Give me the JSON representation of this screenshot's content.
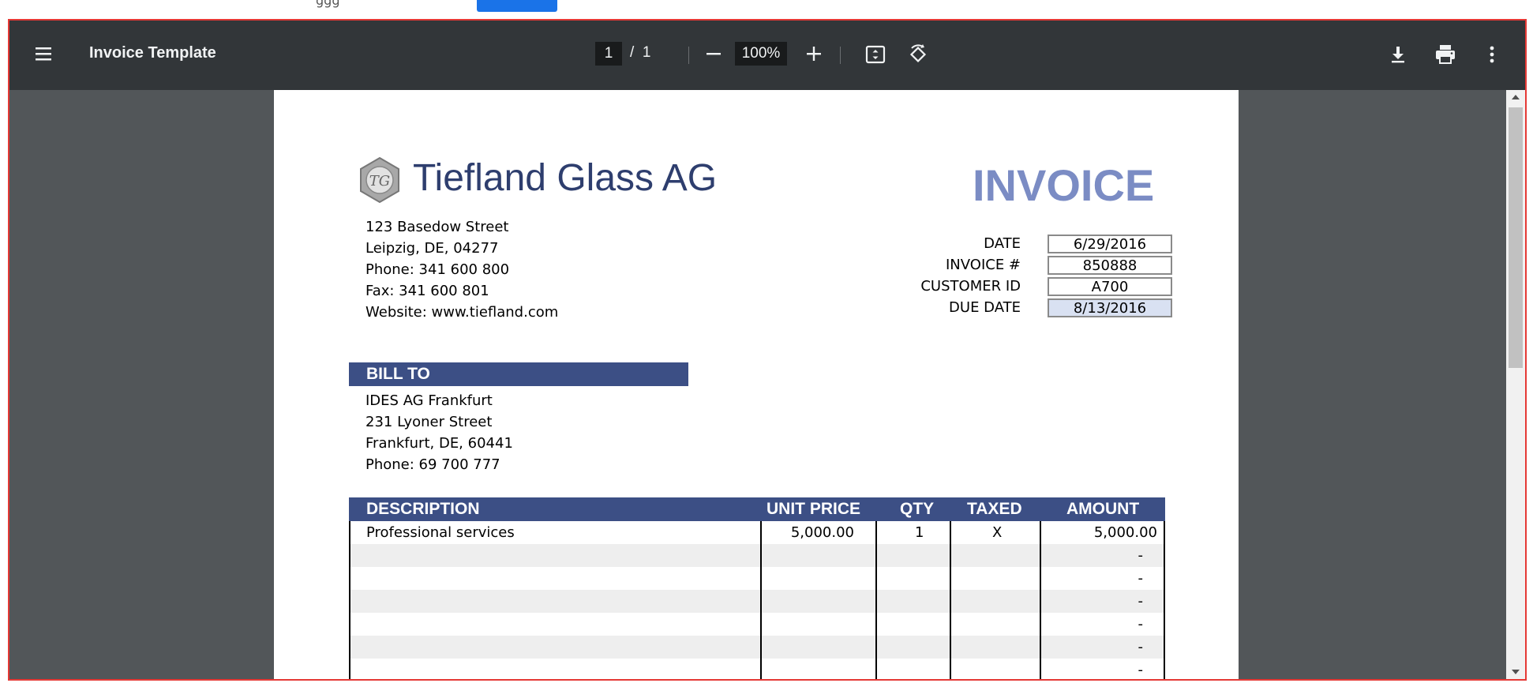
{
  "viewer": {
    "title": "Invoice Template",
    "page_current": "1",
    "page_separator": "/",
    "page_total": "1",
    "zoom": "100%"
  },
  "icons": [
    "menu-icon",
    "zoom-out-icon",
    "zoom-in-icon",
    "fit-page-icon",
    "rotate-icon",
    "download-icon",
    "print-icon",
    "more-icon"
  ],
  "invoice": {
    "company_name": "Tiefland Glass AG",
    "logo_initials": "TG",
    "address_lines": [
      "123 Basedow Street",
      "Leipzig, DE, 04277",
      "Phone: 341 600 800",
      "Fax: 341 600 801",
      "Website: www.tiefland.com"
    ],
    "title": "INVOICE",
    "meta": [
      {
        "label": "DATE",
        "value": "6/29/2016"
      },
      {
        "label": "INVOICE #",
        "value": "850888"
      },
      {
        "label": "CUSTOMER ID",
        "value": "A700"
      },
      {
        "label": "DUE DATE",
        "value": "8/13/2016"
      }
    ],
    "bill_to_label": "BILL TO",
    "bill_to_lines": [
      "IDES AG Frankfurt",
      "231 Lyoner Street",
      "Frankfurt, DE, 60441",
      "Phone: 69 700 777"
    ],
    "columns": {
      "description": "DESCRIPTION",
      "unit_price": "UNIT PRICE",
      "qty": "QTY",
      "taxed": "TAXED",
      "amount": "AMOUNT"
    },
    "items": [
      {
        "description": "Professional services",
        "unit_price": "5,000.00",
        "qty": "1",
        "taxed": "X",
        "amount": "5,000.00"
      },
      {
        "description": "",
        "unit_price": "",
        "qty": "",
        "taxed": "",
        "amount": "-"
      },
      {
        "description": "",
        "unit_price": "",
        "qty": "",
        "taxed": "",
        "amount": "-"
      },
      {
        "description": "",
        "unit_price": "",
        "qty": "",
        "taxed": "",
        "amount": "-"
      },
      {
        "description": "",
        "unit_price": "",
        "qty": "",
        "taxed": "",
        "amount": "-"
      },
      {
        "description": "",
        "unit_price": "",
        "qty": "",
        "taxed": "",
        "amount": "-"
      },
      {
        "description": "",
        "unit_price": "",
        "qty": "",
        "taxed": "",
        "amount": "-"
      }
    ]
  },
  "colors": {
    "toolbar": "#323639",
    "viewer_bg": "#525659",
    "header_blue": "#3c4f85",
    "invoice_title": "#7b8cc4",
    "company": "#2e3e6e",
    "due_date_fill": "#d9e1f2",
    "highlight_border": "#e53935"
  }
}
